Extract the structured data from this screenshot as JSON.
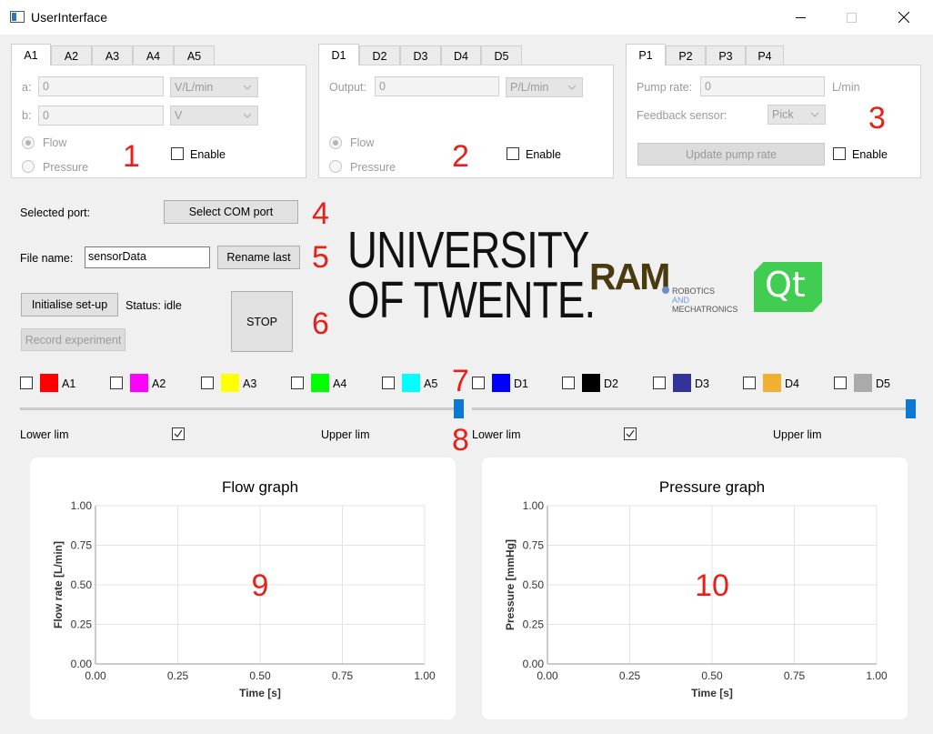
{
  "window": {
    "title": "UserInterface"
  },
  "panel_a": {
    "tabs": [
      "A1",
      "A2",
      "A3",
      "A4",
      "A5"
    ],
    "a_label": "a:",
    "a_value": "0",
    "a_unit": "V/L/min",
    "b_label": "b:",
    "b_value": "0",
    "b_unit": "V",
    "radio_flow": "Flow",
    "radio_pressure": "Pressure",
    "enable": "Enable",
    "marker": "1"
  },
  "panel_d": {
    "tabs": [
      "D1",
      "D2",
      "D3",
      "D4",
      "D5"
    ],
    "output_label": "Output:",
    "output_value": "0",
    "output_unit": "P/L/min",
    "radio_flow": "Flow",
    "radio_pressure": "Pressure",
    "enable": "Enable",
    "marker": "2"
  },
  "panel_p": {
    "tabs": [
      "P1",
      "P2",
      "P3",
      "P4"
    ],
    "pump_label": "Pump rate:",
    "pump_value": "0",
    "pump_unit": "L/min",
    "feedback_label": "Feedback sensor:",
    "feedback_value": "Pick",
    "update_button": "Update pump rate",
    "enable": "Enable",
    "marker": "3"
  },
  "controls": {
    "selected_port_label": "Selected port:",
    "select_com_button": "Select COM port",
    "file_name_label": "File name:",
    "file_name_value": "sensorData",
    "rename_button": "Rename last",
    "init_button": "Initialise set-up",
    "status_text": "Status: idle",
    "record_button": "Record experiment",
    "stop_button": "STOP",
    "markers": [
      "4",
      "5",
      "6",
      "7",
      "8"
    ]
  },
  "logos": {
    "ut_line1": "UNIVERSITY",
    "ut_line2": "OF TWENTE.",
    "ram_text": "RAM",
    "ram_sub1": "ROBOTICS",
    "ram_sub2": "AND",
    "ram_sub3": "MECHATRONICS",
    "qt_text": "Qt"
  },
  "channels": [
    {
      "label": "A1",
      "color": "#ff0000"
    },
    {
      "label": "A2",
      "color": "#ff00ff"
    },
    {
      "label": "A3",
      "color": "#ffff00"
    },
    {
      "label": "A4",
      "color": "#00ff00"
    },
    {
      "label": "A5",
      "color": "#00ffff"
    },
    {
      "label": "D1",
      "color": "#0000ff"
    },
    {
      "label": "D2",
      "color": "#000000"
    },
    {
      "label": "D3",
      "color": "#333399"
    },
    {
      "label": "D4",
      "color": "#f0b030"
    },
    {
      "label": "D5",
      "color": "#aaaaaa"
    }
  ],
  "limits": {
    "left_lower": "Lower lim",
    "left_upper": "Upper lim",
    "right_lower": "Lower lim",
    "right_upper": "Upper lim"
  },
  "chart_data": [
    {
      "type": "line",
      "title": "Flow graph",
      "xlabel": "Time [s]",
      "ylabel": "Flow rate [L/min]",
      "xlim": [
        0,
        1
      ],
      "ylim": [
        0,
        1
      ],
      "xticks": [
        "0.00",
        "0.25",
        "0.50",
        "0.75",
        "1.00"
      ],
      "yticks": [
        "0.00",
        "0.25",
        "0.50",
        "0.75",
        "1.00"
      ],
      "grid": true,
      "series": [],
      "annotation": "9"
    },
    {
      "type": "line",
      "title": "Pressure graph",
      "xlabel": "Time [s]",
      "ylabel": "Pressure [mmHg]",
      "xlim": [
        0,
        1
      ],
      "ylim": [
        0,
        1
      ],
      "xticks": [
        "0.00",
        "0.25",
        "0.50",
        "0.75",
        "1.00"
      ],
      "yticks": [
        "0.00",
        "0.25",
        "0.50",
        "0.75",
        "1.00"
      ],
      "grid": true,
      "series": [],
      "annotation": "10"
    }
  ]
}
